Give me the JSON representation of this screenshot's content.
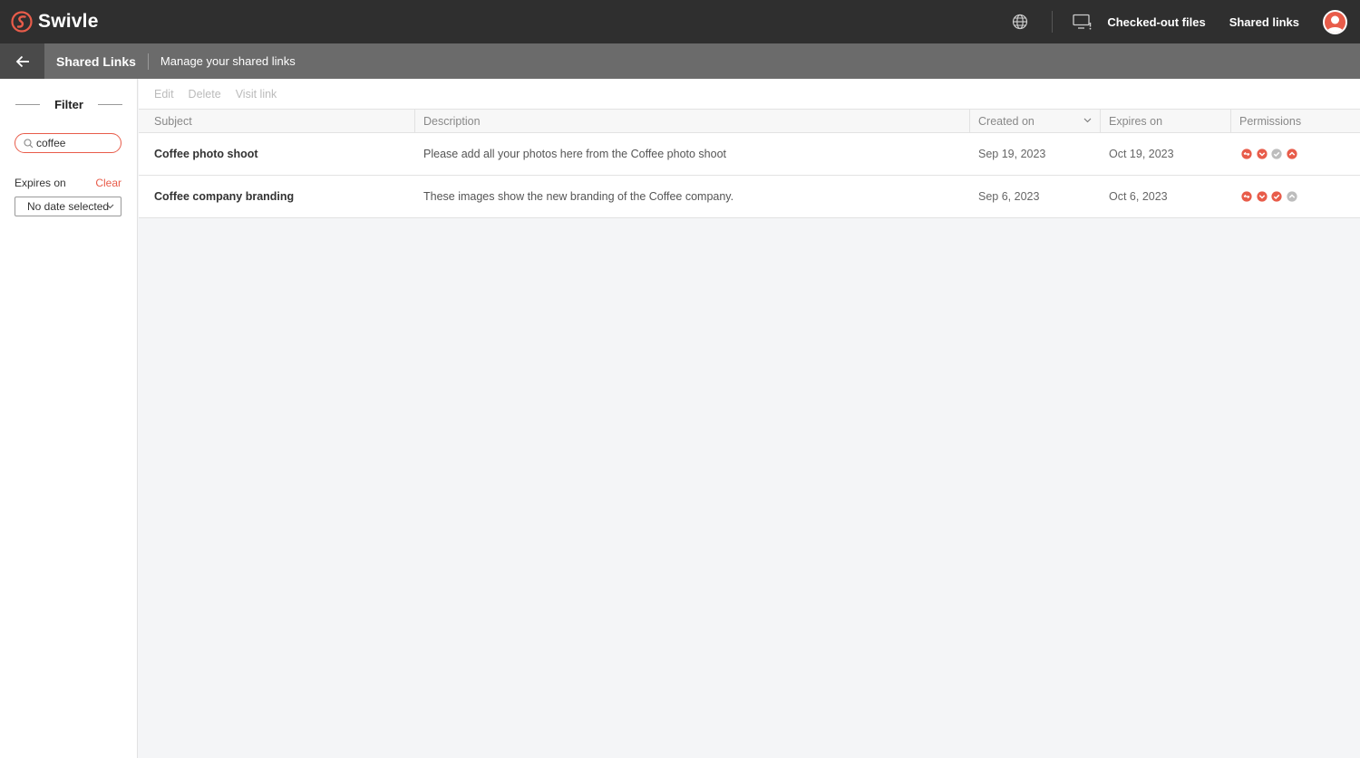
{
  "app": {
    "name": "Swivle",
    "brand_color": "#e85c4a"
  },
  "topbar": {
    "checked_out_label": "Checked-out files",
    "shared_links_label": "Shared links"
  },
  "subbar": {
    "title": "Shared Links",
    "description": "Manage your shared links"
  },
  "sidebar": {
    "filter_label": "Filter",
    "search_value": "coffee",
    "expires_label": "Expires on",
    "clear_label": "Clear",
    "date_select_value": "No date selected"
  },
  "toolbar": {
    "edit_label": "Edit",
    "delete_label": "Delete",
    "visit_label": "Visit link"
  },
  "table": {
    "columns": [
      "Subject",
      "Description",
      "Created on",
      "Expires on",
      "Permissions"
    ],
    "rows": [
      {
        "subject": "Coffee photo shoot",
        "description": "Please add all your photos here from the Coffee photo shoot",
        "created": "Sep 19, 2023",
        "expires": "Oct 19, 2023",
        "permissions": [
          {
            "icon": "view-icon",
            "enabled": true
          },
          {
            "icon": "download-icon",
            "enabled": true
          },
          {
            "icon": "check-icon",
            "enabled": false
          },
          {
            "icon": "upload-icon",
            "enabled": true
          }
        ]
      },
      {
        "subject": "Coffee company branding",
        "description": "These images show the new branding of the Coffee company.",
        "created": "Sep 6, 2023",
        "expires": "Oct 6, 2023",
        "permissions": [
          {
            "icon": "view-icon",
            "enabled": true
          },
          {
            "icon": "download-icon",
            "enabled": true
          },
          {
            "icon": "check-icon",
            "enabled": true
          },
          {
            "icon": "upload-icon",
            "enabled": false
          }
        ]
      }
    ]
  }
}
